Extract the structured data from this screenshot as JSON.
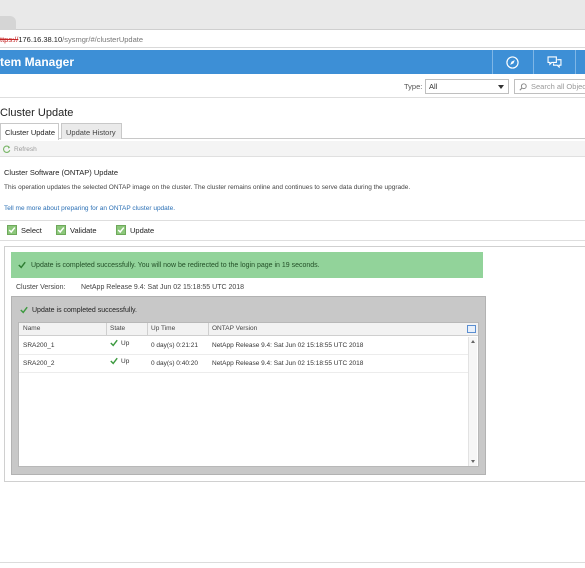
{
  "browser": {
    "url_protocol": "ttps://",
    "url_host": "176.16.38.10",
    "url_path": "/sysmgr/#/clusterUpdate"
  },
  "header": {
    "title": "tem Manager",
    "icons": [
      "compass-icon",
      "chat-icon"
    ]
  },
  "toolbar": {
    "type_label": "Type:",
    "type_value": "All",
    "search_placeholder": "Search all Objects"
  },
  "page": {
    "title": "Cluster Update",
    "tabs": [
      {
        "label": "Cluster Update",
        "active": true
      },
      {
        "label": "Update History",
        "active": false
      }
    ],
    "refresh_label": "Refresh"
  },
  "section": {
    "title": "Cluster Software (ONTAP) Update",
    "description": "This operation updates the selected ONTAP image on the cluster. The cluster remains online and continues to serve data during the upgrade.",
    "link": "Tell me more about preparing for an ONTAP cluster update."
  },
  "steps": [
    {
      "label": "Select",
      "done": true
    },
    {
      "label": "Validate",
      "done": true
    },
    {
      "label": "Update",
      "done": true
    }
  ],
  "status": {
    "banner": "Update is completed successfully. You will now be redirected to the login page in 19 seconds.",
    "cluster_version_label": "Cluster Version:",
    "cluster_version_value": "NetApp Release 9.4: Sat Jun 02 15:18:55 UTC 2018",
    "inner_message": "Update is completed successfully."
  },
  "grid": {
    "columns": [
      "Name",
      "State",
      "Up Time",
      "ONTAP Version"
    ],
    "rows": [
      {
        "name": "SRA200_1",
        "state": "Up",
        "uptime": "0 day(s) 0:21:21",
        "version": "NetApp Release 9.4: Sat Jun 02 15:18:55 UTC 2018"
      },
      {
        "name": "SRA200_2",
        "state": "Up",
        "uptime": "0 day(s) 0:40:20",
        "version": "NetApp Release 9.4: Sat Jun 02 15:18:55 UTC 2018"
      }
    ]
  },
  "colors": {
    "header_bg": "#3d8fd6",
    "success_bg": "#92d39a",
    "check_green": "#6ab04c",
    "link": "#2a6fb5"
  }
}
